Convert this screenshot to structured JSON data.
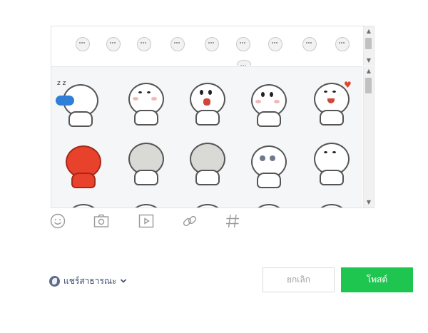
{
  "composer": {
    "tools": [
      {
        "icon": "smiley-icon"
      },
      {
        "icon": "camera-icon"
      },
      {
        "icon": "video-icon"
      },
      {
        "icon": "link-icon"
      },
      {
        "icon": "hashtag-icon"
      }
    ],
    "sticker_set_count": 10,
    "sticker_count": 15
  },
  "footer": {
    "privacy_label": "แชร์สาธารณะ",
    "privacy_icon": "globe-icon",
    "cancel_label": "ยกเลิก",
    "post_label": "โพสต์"
  },
  "colors": {
    "accent": "#1ec64f",
    "panel_bg": "#f5f6f7",
    "border": "#e3e3e3"
  }
}
